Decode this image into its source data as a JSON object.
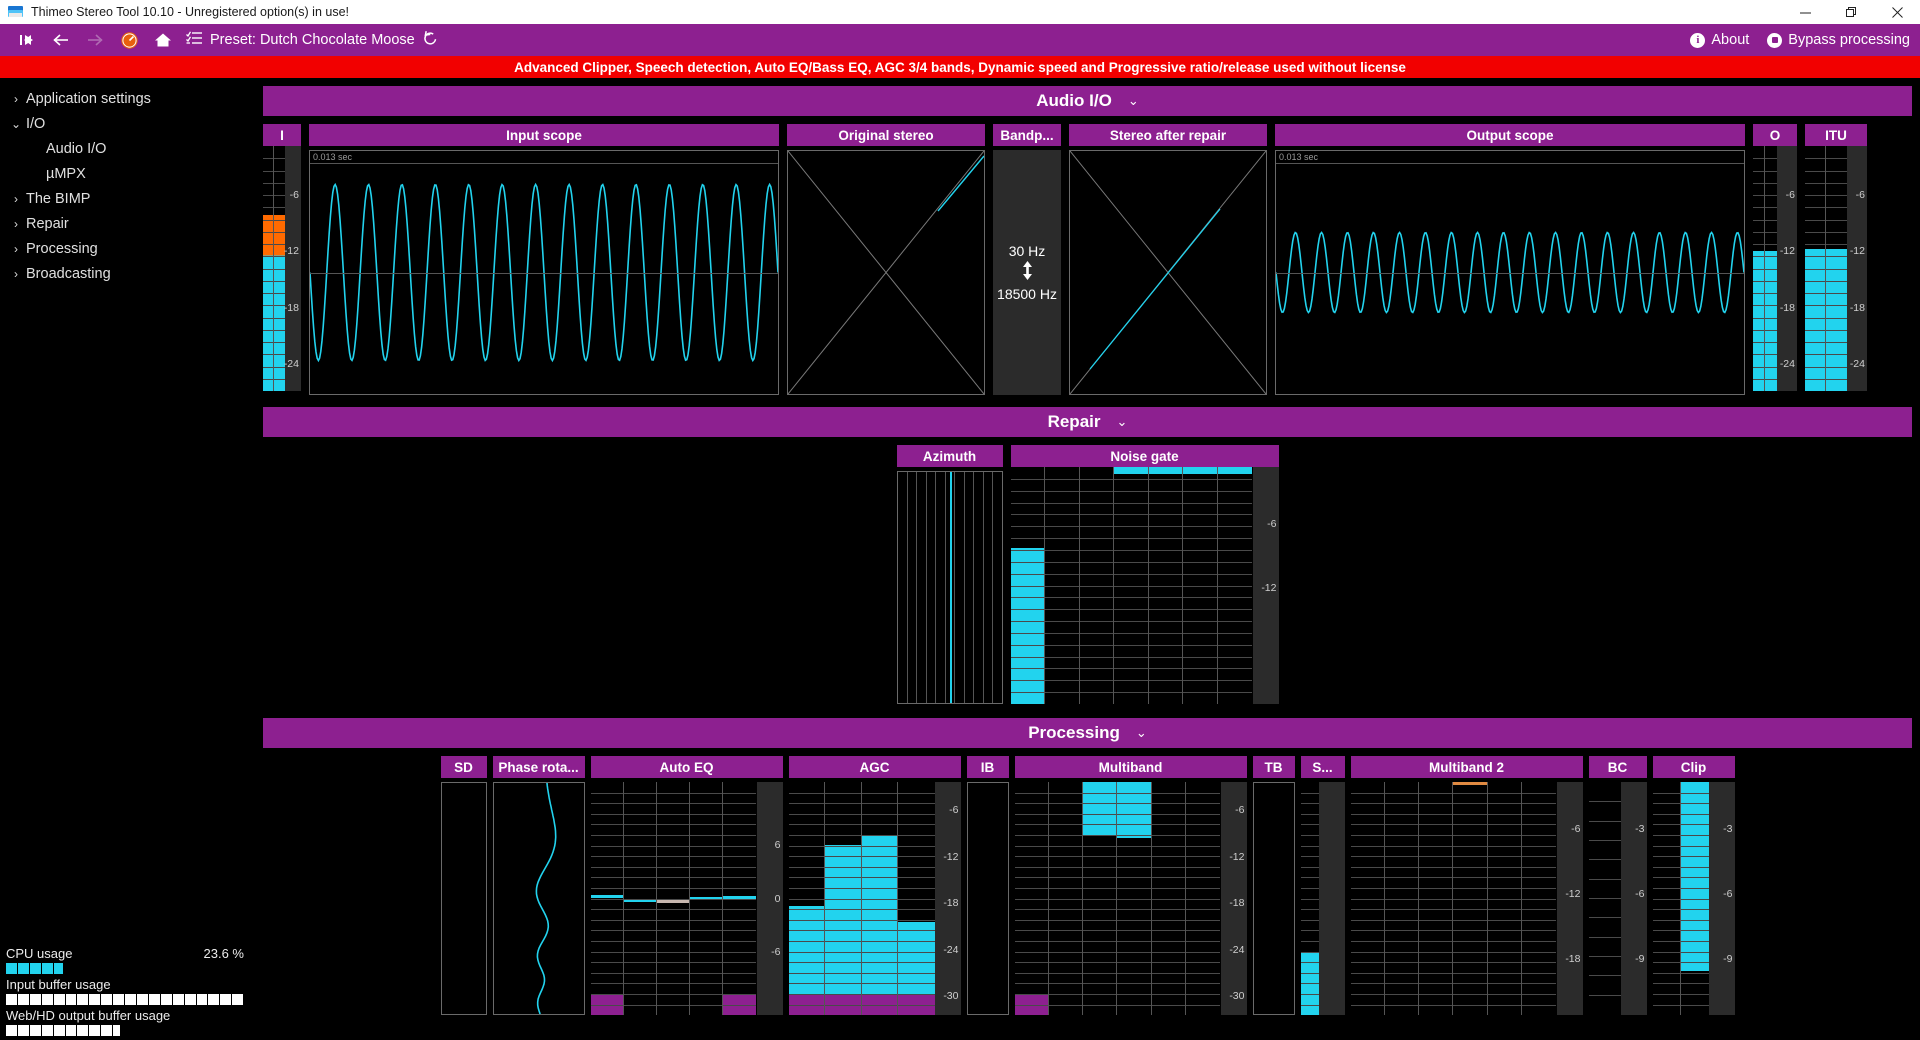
{
  "window": {
    "title": "Thimeo Stereo Tool 10.10 - Unregistered option(s) in use!",
    "app_icon": "stereo-tool-icon",
    "minimize": "—",
    "maximize": "❐",
    "close": "✕"
  },
  "toolbar": {
    "first_label": "I▸",
    "back_label": "←",
    "forward_label": "→",
    "meter_label": "gauge-icon",
    "home_label": "⌂",
    "list_label": "list-icon",
    "preset_label": "Preset: Dutch Chocolate Moose",
    "reset_label": "↺",
    "about_label": "About",
    "about_icon": "i",
    "bypass_label": "Bypass processing"
  },
  "warning": {
    "text": "Advanced Clipper, Speech detection, Auto EQ/Bass EQ, AGC 3/4 bands, Dynamic speed and Progressive ratio/release used without license"
  },
  "sidebar": {
    "items": [
      {
        "label": "Application settings",
        "chev": "›",
        "level": 0
      },
      {
        "label": "I/O",
        "chev": "⌄",
        "level": 0
      },
      {
        "label": "Audio I/O",
        "chev": "",
        "level": 1
      },
      {
        "label": "µMPX",
        "chev": "",
        "level": 1
      },
      {
        "label": "The BIMP",
        "chev": "›",
        "level": 0
      },
      {
        "label": "Repair",
        "chev": "›",
        "level": 0
      },
      {
        "label": "Processing",
        "chev": "›",
        "level": 0
      },
      {
        "label": "Broadcasting",
        "chev": "›",
        "level": 0
      }
    ],
    "status": {
      "cpu_label": "CPU usage",
      "cpu_value": "23.6 %",
      "cpu_percent": 24,
      "input_label": "Input buffer usage",
      "input_percent": 100,
      "output_label": "Web/HD output buffer usage",
      "output_percent": 48
    }
  },
  "sections": [
    {
      "id": "audio-io",
      "title": "Audio I/O",
      "chev": "⌄"
    },
    {
      "id": "repair",
      "title": "Repair",
      "chev": "⌄"
    },
    {
      "id": "processing",
      "title": "Processing",
      "chev": "⌄"
    }
  ],
  "audio_io": {
    "input_meter": {
      "title": "I",
      "scale": [
        "-6",
        "-12",
        "-18",
        "-24"
      ]
    },
    "input_scope": {
      "title": "Input scope",
      "time_label": "0.013 sec"
    },
    "original_stereo": {
      "title": "Original stereo"
    },
    "bandpass": {
      "title": "Bandp...",
      "low": "30 Hz",
      "arrow": "↕",
      "high": "18500 Hz"
    },
    "stereo_after_repair": {
      "title": "Stereo after repair"
    },
    "output_scope": {
      "title": "Output scope",
      "time_label": "0.013 sec"
    },
    "output_meter": {
      "title": "O",
      "scale": [
        "-6",
        "-12",
        "-18",
        "-24"
      ]
    },
    "itu_meter": {
      "title": "ITU",
      "scale": [
        "-6",
        "-12",
        "-18",
        "-24"
      ]
    }
  },
  "repair": {
    "azimuth": {
      "title": "Azimuth"
    },
    "noise_gate": {
      "title": "Noise gate",
      "scale": [
        "-6",
        "-12"
      ]
    }
  },
  "processing": {
    "panels": [
      {
        "title": "SD"
      },
      {
        "title": "Phase rota..."
      },
      {
        "title": "Auto EQ",
        "scale": [
          "6",
          "0",
          "-6"
        ]
      },
      {
        "title": "AGC",
        "scale": [
          "-6",
          "-12",
          "-18",
          "-24",
          "-30"
        ]
      },
      {
        "title": "IB"
      },
      {
        "title": "Multiband",
        "scale": [
          "-6",
          "-12",
          "-18",
          "-24",
          "-30"
        ]
      },
      {
        "title": "TB"
      },
      {
        "title": "S..."
      },
      {
        "title": "Multiband 2",
        "scale": [
          "-6",
          "-12",
          "-18"
        ]
      },
      {
        "title": "BC",
        "scale": [
          "-3",
          "-6",
          "-9"
        ]
      },
      {
        "title": "Clip",
        "scale": [
          "-3",
          "-6",
          "-9"
        ]
      }
    ]
  },
  "chart_data": {
    "type": "bar",
    "title": "Stereo Tool meters",
    "meters": {
      "input_I": {
        "channels": [
          72,
          72
        ],
        "peak_color": "#ff6a00",
        "body_color": "#22d3ee"
      },
      "output_O": {
        "channels": [
          57,
          57
        ]
      },
      "itu": {
        "channels": [
          58,
          58
        ]
      },
      "noise_gate": {
        "bars": [
          66,
          0,
          0,
          3,
          3,
          3,
          3
        ]
      },
      "auto_eq": {
        "bars": [
          0.2,
          0.0,
          -0.1,
          0.1,
          0.15
        ]
      },
      "agc": {
        "bars": [
          47,
          73,
          77,
          40
        ]
      },
      "multiband": {
        "bars": [
          0,
          0,
          23,
          24,
          0,
          0
        ]
      },
      "multiband2": {
        "bars": [
          0,
          0,
          0,
          0,
          0,
          0
        ]
      },
      "speech": {
        "bars": [
          27
        ]
      },
      "clip": {
        "bars": [
          0,
          81
        ]
      }
    }
  },
  "colors": {
    "accent": "#8d2090",
    "warning": "#f20000",
    "meter_cyan": "#22d3ee",
    "meter_orange": "#ff6a00",
    "panel_dark": "#2b2b2b"
  }
}
